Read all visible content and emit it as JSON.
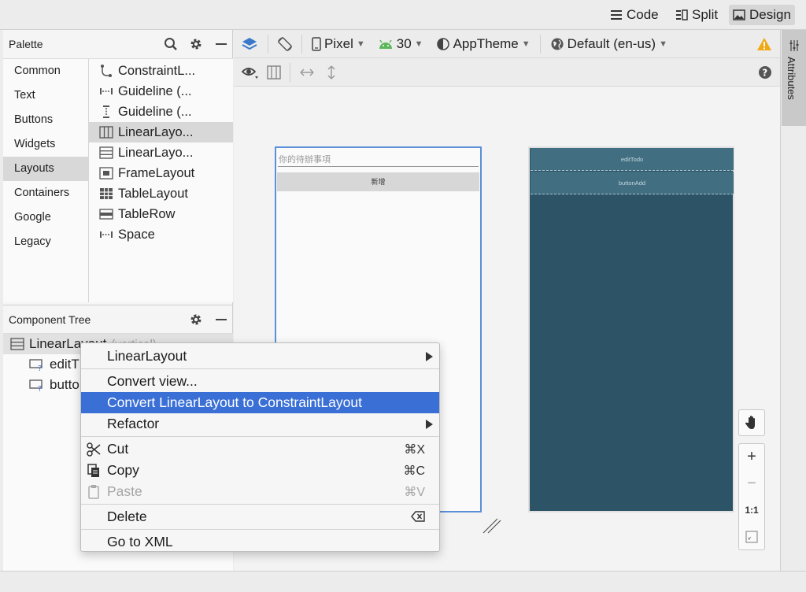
{
  "view_modes": {
    "code": "Code",
    "split": "Split",
    "design": "Design"
  },
  "palette": {
    "title": "Palette",
    "categories": [
      "Common",
      "Text",
      "Buttons",
      "Widgets",
      "Layouts",
      "Containers",
      "Google",
      "Legacy"
    ],
    "selected_category": "Layouts",
    "items": [
      "ConstraintL...",
      "Guideline (...",
      "Guideline (...",
      "LinearLayo...",
      "LinearLayo...",
      "FrameLayout",
      "TableLayout",
      "TableRow",
      "Space"
    ]
  },
  "component_tree": {
    "title": "Component Tree",
    "root_label": "LinearLayout",
    "root_hint": "(vertical)",
    "children": [
      "editT",
      "butto"
    ]
  },
  "toolbar": {
    "device": "Pixel",
    "api_level": "30",
    "theme": "AppTheme",
    "locale": "Default (en-us)"
  },
  "preview": {
    "input_hint": "你的待辦事項",
    "button_text": "新增",
    "blueprint_rows": [
      "editTodo",
      "buttonAdd"
    ]
  },
  "zoom": {
    "in": "+",
    "out": "−",
    "actual": "1:1"
  },
  "right_panel": {
    "attributes_label": "Attributes"
  },
  "context_menu": {
    "items": [
      {
        "label": "LinearLayout",
        "shortcut": ""
      },
      {
        "label": "Convert view...",
        "shortcut": ""
      },
      {
        "label": "Convert LinearLayout to ConstraintLayout",
        "shortcut": ""
      },
      {
        "label": "Refactor",
        "shortcut": ""
      },
      {
        "label": "Cut",
        "shortcut": "⌘X"
      },
      {
        "label": "Copy",
        "shortcut": "⌘C"
      },
      {
        "label": "Paste",
        "shortcut": "⌘V"
      },
      {
        "label": "Delete",
        "shortcut": ""
      },
      {
        "label": "Go to XML",
        "shortcut": ""
      }
    ]
  },
  "colors": {
    "highlight": "#3a6fd6",
    "blueprint": "#2d5466",
    "selection_border": "#5b8fd8"
  }
}
